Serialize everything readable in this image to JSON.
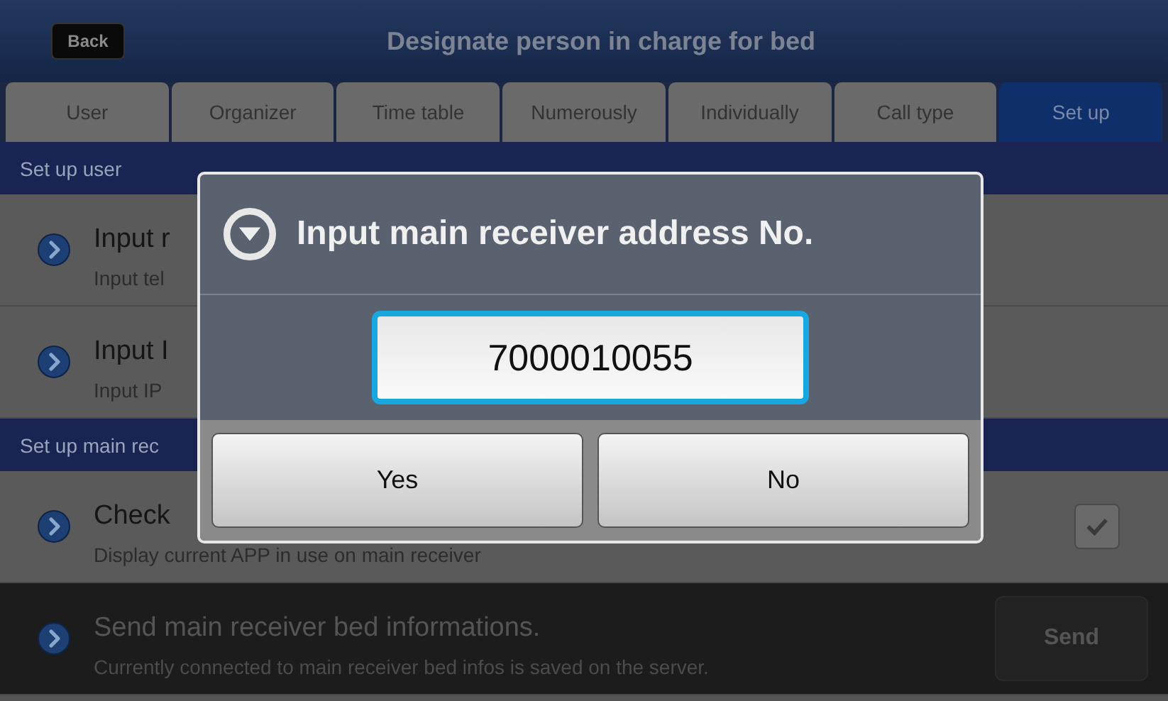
{
  "header": {
    "back_button": "Back",
    "title": "Designate person in charge for bed"
  },
  "tabs": [
    {
      "label": "User",
      "selected": false
    },
    {
      "label": "Organizer",
      "selected": false
    },
    {
      "label": "Time table",
      "selected": false
    },
    {
      "label": "Numerously",
      "selected": false
    },
    {
      "label": "Individually",
      "selected": false
    },
    {
      "label": "Call type",
      "selected": false
    },
    {
      "label": "Set up",
      "selected": true
    }
  ],
  "sections": [
    {
      "title": "Set up user",
      "rows": [
        {
          "kind": "plain",
          "title": "Input r",
          "subtitle": "Input tel",
          "disabled": false
        },
        {
          "kind": "plain",
          "title": "Input I",
          "subtitle": "Input IP",
          "disabled": false
        }
      ]
    },
    {
      "title": "Set up main rec",
      "rows": [
        {
          "kind": "checkbox",
          "title": "Check",
          "subtitle": "Display current APP in use on main receiver",
          "checked": true,
          "disabled": false
        },
        {
          "kind": "button",
          "title": "Send main receiver bed informations.",
          "subtitle": "Currently connected to main receiver bed infos is saved on the server.",
          "button": "Send",
          "disabled": true
        }
      ]
    }
  ],
  "dialog": {
    "title": "Input main receiver address No.",
    "value": "7000010055",
    "buttons": [
      "Yes",
      "No"
    ]
  }
}
